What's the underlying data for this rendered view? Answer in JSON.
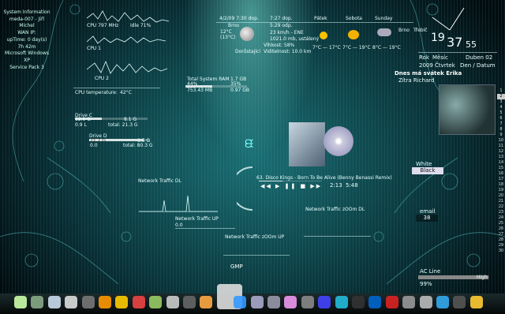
{
  "sysinfo": {
    "title": "System Information",
    "host": "meda-007 - Jiří Michel",
    "wan": "WAN IP:",
    "uptime": "upTime: 0 day(s) 7h 42m",
    "os": "Microsoft Windows XP",
    "sp": "Service Pack 3"
  },
  "cpu": {
    "freq": "CPU 797 MHz",
    "idle": "Idle 71%",
    "cpu1": "CPU 1",
    "cpu2": "CPU 2",
    "temp_label": "CPU temperature:",
    "temp_value": "42°C"
  },
  "ram": {
    "title": "Total System RAM",
    "total": "1.7 GB",
    "pct1": "44%",
    "pct2": "35%",
    "used": "753.43 MB",
    "free": "0.97 GB"
  },
  "drives": [
    {
      "name": "Drive C",
      "size": "8.1 G",
      "used": "12.0 G",
      "free": "0.9 L",
      "total": "total: 21.3 G",
      "fill": 0.37
    },
    {
      "name": "Drive D",
      "size": "8.5 G",
      "used": "71.7 G",
      "free": "0.0",
      "total": "total: 80.3 G",
      "fill": 0.9
    }
  ],
  "weather": {
    "date": "4/2/09 7:30 dop.",
    "sunrise": "7:27 dop.",
    "sunset": "5:29 odp.",
    "city": "Brno",
    "temp": "12°C",
    "feels": "(13°C)",
    "wind": "23 km/h - ENE",
    "pressure": "1021.0 mb, ustálený",
    "humidity": "Vlhkost: 58%",
    "visibility": "Viditelnost: 10.0 km",
    "moon": "Dorůstající",
    "days": [
      {
        "name": "Pátek",
        "range": "7°C — 17°C"
      },
      {
        "name": "Sobota",
        "range": "7°C — 19°C"
      },
      {
        "name": "Sunday",
        "range": "8°C — 19°C"
      }
    ],
    "brno": "Brno",
    "trebic": "Třebíč"
  },
  "clock": {
    "hour": "19",
    "minute": "37",
    "second": "55",
    "rok": "Rok",
    "mesic": "Měsíc",
    "month": "Duben 02",
    "year_day": "2009 Čtvrtek",
    "den": "Den / Datum",
    "nameday_title": "Dnes má svátek Erika",
    "other": "Zítra Richard"
  },
  "music": {
    "track": "63. Disco Kings - Born To Be Alive (Benny Benassi Remix)",
    "elapsed": "2:13",
    "total": "5:48",
    "player": "GMP"
  },
  "net": {
    "dl": "Network Traffic DL",
    "up": "Network Traffic UP",
    "up_value": "0.0",
    "zoom_dl": "Network Traffic zOOm DL",
    "zoom_up": "Network Traffic zOOm UP"
  },
  "theme": {
    "white": "White",
    "black": "Black"
  },
  "email": {
    "label": "email",
    "count": "38"
  },
  "power": {
    "label": "AC Line",
    "status": "High",
    "pct": "99%",
    "fill": 0.99
  },
  "calendar": [
    "1",
    "2",
    "3",
    "4",
    "5",
    "6",
    "7",
    "8",
    "9",
    "10",
    "11",
    "12",
    "13",
    "14",
    "15",
    "16",
    "17",
    "18",
    "19",
    "20",
    "21",
    "22",
    "23",
    "24",
    "25",
    "26",
    "27",
    "28",
    "29",
    "30"
  ],
  "dock_icons": [
    "home-icon",
    "recycle-bin-icon",
    "globe-icon",
    "lock-icon",
    "user-icon",
    "flower-icon",
    "duck-icon",
    "ball-icon",
    "mu-icon",
    "media-icon",
    "film-icon",
    "brush-icon",
    "gimp-icon",
    "cup-icon",
    "photo-icon",
    "tools-icon",
    "puzzle-icon",
    "gear-icon",
    "user2-icon",
    "target-icon",
    "terminal-icon",
    "blue-icon",
    "red-icon",
    "printer-icon",
    "camera-icon",
    "book-icon",
    "clock-icon",
    "moon-icon"
  ]
}
